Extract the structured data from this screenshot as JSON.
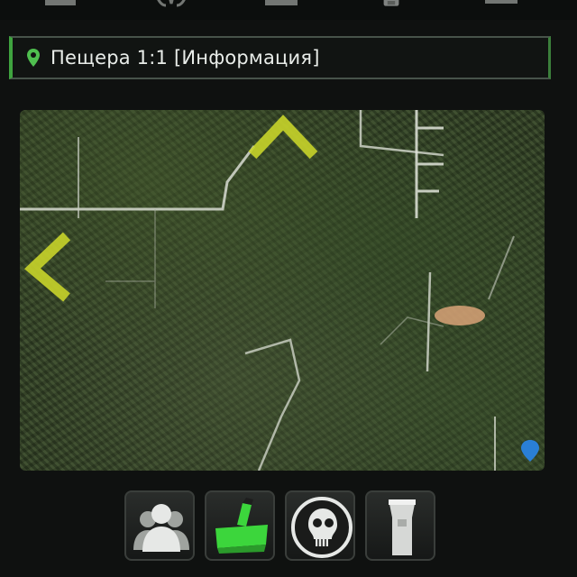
{
  "header": {
    "top_icons": [
      "map-icon",
      "radiation-icon",
      "monitor-icon",
      "backpack-icon",
      "menu-icon"
    ]
  },
  "location": {
    "icon": "location-pin-icon",
    "title": "Пещера 1:1 [Информация]",
    "accent_color": "#3fa43f"
  },
  "map": {
    "markers": [
      {
        "icon": "chevron-up-icon",
        "color": "#c8d42a"
      },
      {
        "icon": "chevron-left-icon",
        "color": "#c8d42a"
      },
      {
        "icon": "player-marker-icon",
        "color": "#d9a378"
      },
      {
        "icon": "blue-pin-icon",
        "color": "#2a7fd6"
      }
    ]
  },
  "actions": [
    {
      "icon": "group-icon"
    },
    {
      "icon": "green-item-icon",
      "color": "#3cd63c"
    },
    {
      "icon": "skull-icon"
    },
    {
      "icon": "flashlight-icon"
    }
  ]
}
